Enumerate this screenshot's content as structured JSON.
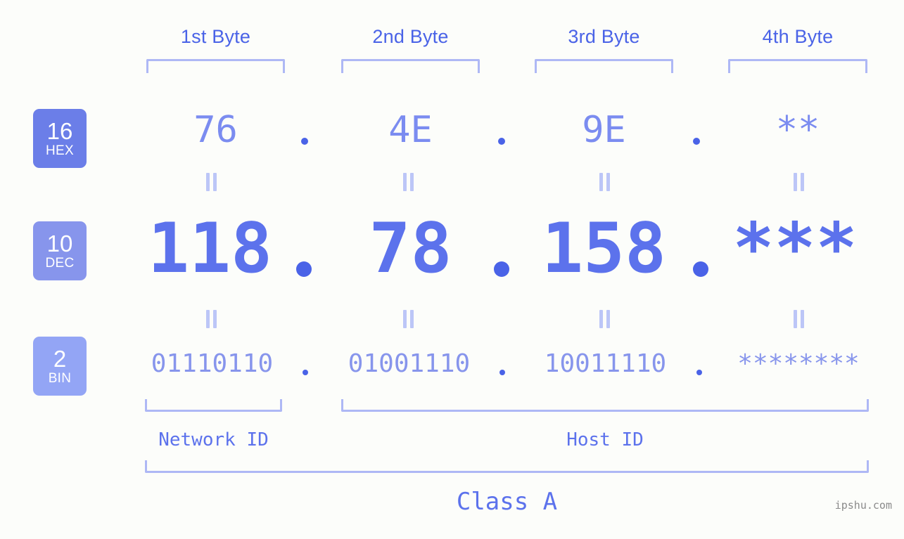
{
  "meta": {
    "watermark": "ipshu.com",
    "background_color": "#fcfdfa",
    "accent_color": "#4a63e7",
    "bracket_color": "#aeb8f5"
  },
  "byte_headers": [
    {
      "label": "1st Byte"
    },
    {
      "label": "2nd Byte"
    },
    {
      "label": "3rd Byte"
    },
    {
      "label": "4th Byte"
    }
  ],
  "rows": [
    {
      "badge_number": "16",
      "badge_word": "HEX",
      "badge_color": "#6b7ee8",
      "values": [
        "76",
        "4E",
        "9E",
        "**"
      ],
      "separator": "."
    },
    {
      "badge_number": "10",
      "badge_word": "DEC",
      "badge_color": "#8795ec",
      "values": [
        "118",
        "78",
        "158",
        "***"
      ],
      "separator": "."
    },
    {
      "badge_number": "2",
      "badge_word": "BIN",
      "badge_color": "#93a5f5",
      "values": [
        "01110110",
        "01001110",
        "10011110",
        "********"
      ],
      "separator": "."
    }
  ],
  "connectors": {
    "equals_glyph": "||"
  },
  "id_sections": [
    {
      "label": "Network ID"
    },
    {
      "label": "Host ID"
    }
  ],
  "class_section": {
    "label": "Class A"
  }
}
